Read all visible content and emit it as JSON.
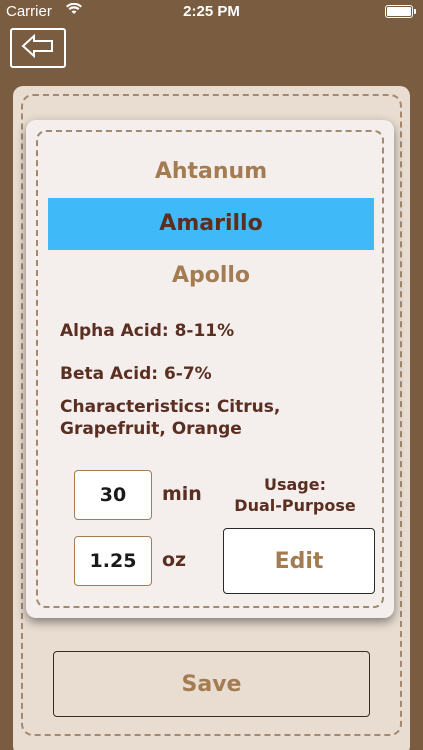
{
  "status_bar": {
    "carrier": "Carrier",
    "wifi_icon": "wifi-icon",
    "time": "2:25 PM",
    "battery_icon": "battery-icon",
    "battery_level": 1.0
  },
  "nav": {
    "back_icon": "back-arrow-icon"
  },
  "picker": {
    "items": [
      "Ahtanum",
      "Amarillo",
      "Apollo"
    ],
    "selected": "Amarillo"
  },
  "details": {
    "alpha_acid": "Alpha Acid: 8-11%",
    "beta_acid": "Beta Acid: 6-7%",
    "characteristics": "Characteristics: Citrus, Grapefruit, Orange"
  },
  "inputs": {
    "time_value": "30",
    "time_unit": "min",
    "amount_value": "1.25",
    "amount_unit": "oz"
  },
  "usage": {
    "label": "Usage:",
    "value": "Dual-Purpose"
  },
  "buttons": {
    "edit": "Edit",
    "save": "Save"
  },
  "colors": {
    "background": "#7a5c40",
    "selection": "#3fb9f7",
    "text_dark": "#5a2e21",
    "text_light": "#a47c52"
  }
}
